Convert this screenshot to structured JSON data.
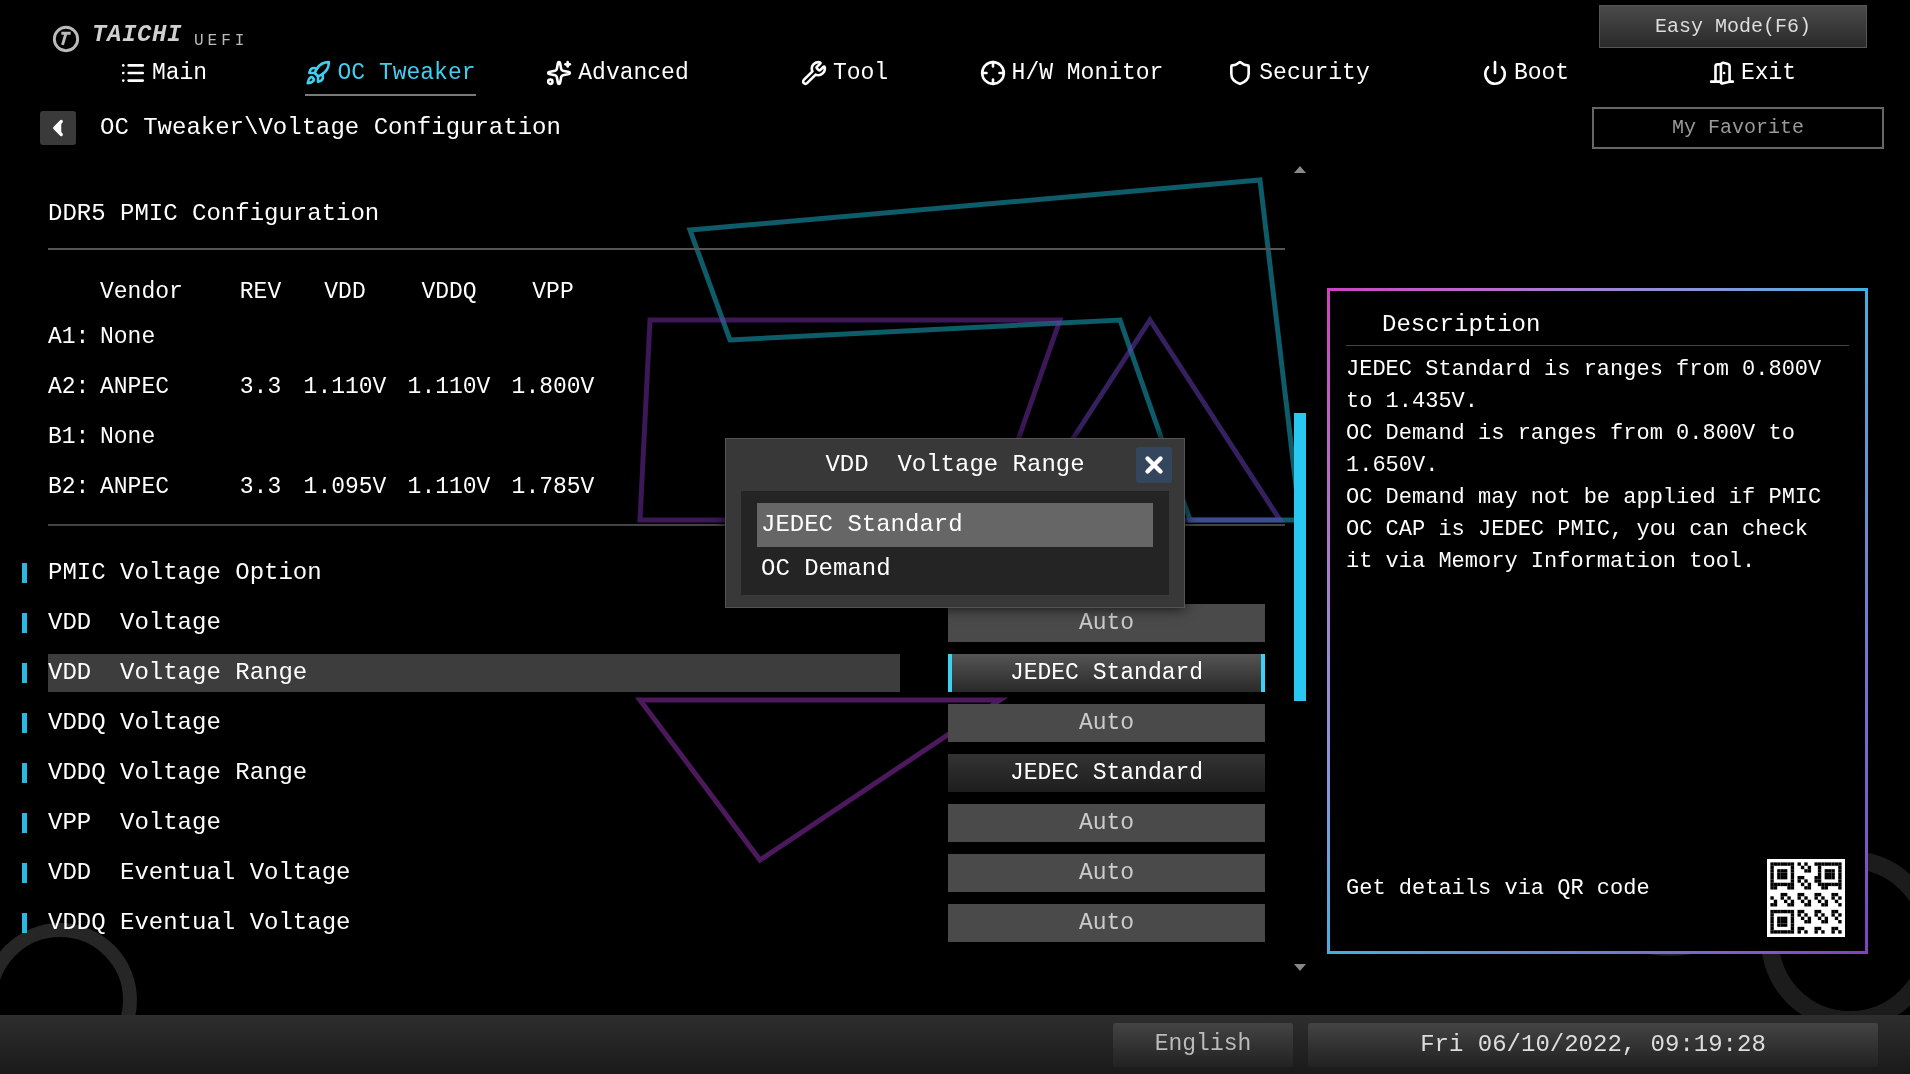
{
  "header": {
    "logo": "TAICHI",
    "logo_sub": "UEFI",
    "easy_mode_button": "Easy Mode(F6)",
    "favorite_button": "My Favorite"
  },
  "tabs": [
    {
      "label": "Main",
      "selected": false
    },
    {
      "label": "OC Tweaker",
      "selected": true
    },
    {
      "label": "Advanced",
      "selected": false
    },
    {
      "label": "Tool",
      "selected": false
    },
    {
      "label": "H/W Monitor",
      "selected": false
    },
    {
      "label": "Security",
      "selected": false
    },
    {
      "label": "Boot",
      "selected": false
    },
    {
      "label": "Exit",
      "selected": false
    }
  ],
  "breadcrumb": "OC Tweaker\\Voltage Configuration",
  "pmic": {
    "title": "DDR5 PMIC Configuration",
    "columns": [
      "Vendor",
      "REV",
      "VDD",
      "VDDQ",
      "VPP"
    ],
    "rows": [
      {
        "slot": "A1:",
        "cells": [
          "None"
        ]
      },
      {
        "slot": "A2:",
        "cells": [
          "ANPEC",
          "3.3",
          "1.110V",
          "1.110V",
          "1.800V"
        ]
      },
      {
        "slot": "B1:",
        "cells": [
          "None"
        ]
      },
      {
        "slot": "B2:",
        "cells": [
          "ANPEC",
          "3.3",
          "1.095V",
          "1.110V",
          "1.785V"
        ]
      }
    ]
  },
  "settings": [
    {
      "label": "PMIC Voltage Option",
      "selected": false
    },
    {
      "label": "VDD  Voltage",
      "value": "Auto",
      "kind": "auto",
      "selected": false
    },
    {
      "label": "VDD  Voltage Range",
      "value": "JEDEC Standard",
      "kind": "option",
      "selected": true
    },
    {
      "label": "VDDQ Voltage",
      "value": "Auto",
      "kind": "auto",
      "selected": false
    },
    {
      "label": "VDDQ Voltage Range",
      "value": "JEDEC Standard",
      "kind": "option",
      "selected": false
    },
    {
      "label": "VPP  Voltage",
      "value": "Auto",
      "kind": "auto",
      "selected": false
    },
    {
      "label": "VDD  Eventual Voltage",
      "value": "Auto",
      "kind": "auto",
      "selected": false
    },
    {
      "label": "VDDQ Eventual Voltage",
      "value": "Auto",
      "kind": "auto",
      "selected": false
    }
  ],
  "popup": {
    "title": "VDD  Voltage Range",
    "options": [
      {
        "label": "JEDEC Standard",
        "selected": true
      },
      {
        "label": "OC Demand",
        "selected": false
      }
    ]
  },
  "description": {
    "title": "Description",
    "paragraphs": [
      "JEDEC Standard is ranges from 0.800V to 1.435V.",
      "OC Demand is ranges from 0.800V to 1.650V.",
      "OC Demand may not be applied if PMIC OC CAP is JEDEC PMIC, you can check it via Memory Information tool."
    ],
    "qr_text": "Get details via QR code"
  },
  "status_bar": {
    "language": "English",
    "datetime": "Fri 06/10/2022, 09:19:28"
  }
}
